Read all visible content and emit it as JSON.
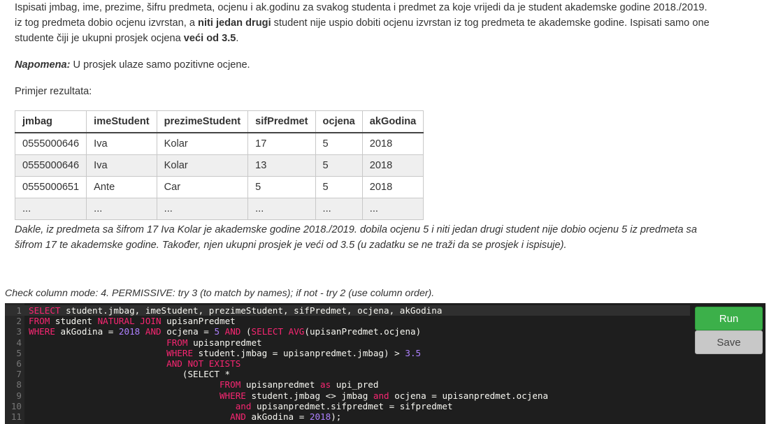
{
  "task": {
    "line1": "Ispisati jmbag, ime, prezime, šifru predmeta, ocjenu i ak.godinu za svakog studenta i predmet za koje vrijedi da je student akademske godine 2018./2019.",
    "line2_pre": "iz tog predmeta dobio ocjenu izvrstan, a ",
    "line2_bold": "niti jedan drugi",
    "line2_post": " student nije uspio dobiti ocjenu izvrstan iz tog predmeta te akademske godine. Ispisati samo one",
    "line3_pre": "studente čiji je ukupni prosjek ocjena ",
    "line3_bold": "veći od 3.5",
    "line3_post": "."
  },
  "note": {
    "label": "Napomena:",
    "text": " U prosjek ulaze samo pozitivne ocjene."
  },
  "example_label": "Primjer rezultata:",
  "table": {
    "headers": [
      "jmbag",
      "imeStudent",
      "prezimeStudent",
      "sifPredmet",
      "ocjena",
      "akGodina"
    ],
    "rows": [
      [
        "0555000646",
        "Iva",
        "Kolar",
        "17",
        "5",
        "2018"
      ],
      [
        "0555000646",
        "Iva",
        "Kolar",
        "13",
        "5",
        "2018"
      ],
      [
        "0555000651",
        "Ante",
        "Car",
        "5",
        "5",
        "2018"
      ],
      [
        "...",
        "...",
        "...",
        "...",
        "...",
        "..."
      ]
    ]
  },
  "explanation": {
    "line1": "Dakle, iz predmeta sa šifrom 17 Iva Kolar je akademske godine 2018./2019. dobila ocjenu 5 i niti jedan drugi student nije dobio ocjenu 5 iz predmeta sa",
    "line2": "šifrom 17 te akademske godine. Također, njen ukupni prosjek je veći od 3.5 (u zadatku se ne traži da se prosjek i ispisuje)."
  },
  "check_mode": "Check column mode: 4. PERMISSIVE: try 3 (to match by names); if not - try 2 (use column order).",
  "editor": {
    "lines": [
      [
        [
          "kw",
          "SELECT"
        ],
        [
          "t",
          " student.jmbag, imeStudent, prezimeStudent, sifPredmet, ocjena, akGodina"
        ]
      ],
      [
        [
          "kw",
          "FROM"
        ],
        [
          "t",
          " student "
        ],
        [
          "kw",
          "NATURAL JOIN"
        ],
        [
          "t",
          " upisanPredmet"
        ]
      ],
      [
        [
          "kw",
          "WHERE"
        ],
        [
          "t",
          " akGodina = "
        ],
        [
          "num",
          "2018"
        ],
        [
          "t",
          " "
        ],
        [
          "kw",
          "AND"
        ],
        [
          "t",
          " ocjena = "
        ],
        [
          "num",
          "5"
        ],
        [
          "t",
          " "
        ],
        [
          "kw",
          "AND"
        ],
        [
          "t",
          " ("
        ],
        [
          "kw",
          "SELECT"
        ],
        [
          "t",
          " "
        ],
        [
          "kw",
          "AVG"
        ],
        [
          "t",
          "(upisanPredmet.ocjena)"
        ]
      ],
      [
        [
          "t",
          "                          "
        ],
        [
          "kw",
          "FROM"
        ],
        [
          "t",
          " upisanpredmet"
        ]
      ],
      [
        [
          "t",
          "                          "
        ],
        [
          "kw",
          "WHERE"
        ],
        [
          "t",
          " student.jmbag = upisanpredmet.jmbag) > "
        ],
        [
          "num",
          "3.5"
        ]
      ],
      [
        [
          "t",
          "                          "
        ],
        [
          "kw",
          "AND NOT EXISTS"
        ]
      ],
      [
        [
          "t",
          "                             (SELECT *"
        ]
      ],
      [
        [
          "t",
          "                                    "
        ],
        [
          "kw",
          "FROM"
        ],
        [
          "t",
          " upisanpredmet "
        ],
        [
          "kw",
          "as"
        ],
        [
          "t",
          " upi_pred"
        ]
      ],
      [
        [
          "t",
          "                                    "
        ],
        [
          "kw",
          "WHERE"
        ],
        [
          "t",
          " student.jmbag <> jmbag "
        ],
        [
          "kw",
          "and"
        ],
        [
          "t",
          " ocjena = upisanpredmet.ocjena"
        ]
      ],
      [
        [
          "t",
          "                                       "
        ],
        [
          "kw",
          "and"
        ],
        [
          "t",
          " upisanpredmet.sifpredmet = sifpredmet"
        ]
      ],
      [
        [
          "t",
          "                                      "
        ],
        [
          "kw",
          "AND"
        ],
        [
          "t",
          " akGodina = "
        ],
        [
          "num",
          "2018"
        ],
        [
          "t",
          ");"
        ]
      ]
    ]
  },
  "buttons": {
    "run": "Run",
    "save": "Save"
  },
  "colors": {
    "run_button": "#3cb04a",
    "save_button": "#c8c8c8",
    "editor_bg": "#1e1e1e",
    "keyword": "#f92672",
    "number": "#ae81ff"
  }
}
